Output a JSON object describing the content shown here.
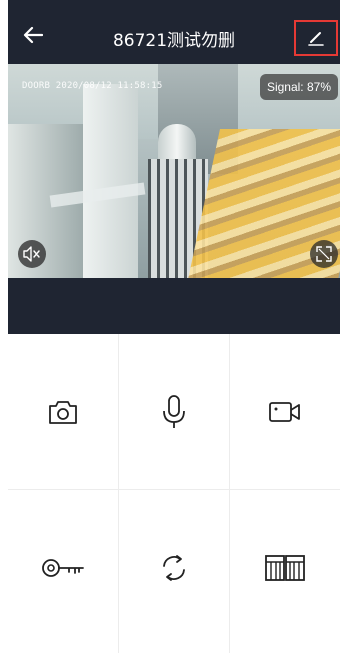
{
  "header": {
    "title": "86721测试勿删",
    "back_icon": "back-arrow-icon",
    "edit_icon": "pencil-icon",
    "highlight_color": "#e53935",
    "bg_color": "#1f2532"
  },
  "video": {
    "timestamp": "DOORB 2020/08/12 11:58:15",
    "signal": "Signal: 87%",
    "mute_icon": "speaker-muted-icon",
    "fullscreen_icon": "fullscreen-icon"
  },
  "controls": [
    {
      "id": "snapshot",
      "icon": "camera-icon"
    },
    {
      "id": "talk",
      "icon": "microphone-icon"
    },
    {
      "id": "record",
      "icon": "video-camera-icon"
    },
    {
      "id": "unlock",
      "icon": "key-icon"
    },
    {
      "id": "refresh",
      "icon": "refresh-icon"
    },
    {
      "id": "gate",
      "icon": "gate-icon"
    }
  ]
}
